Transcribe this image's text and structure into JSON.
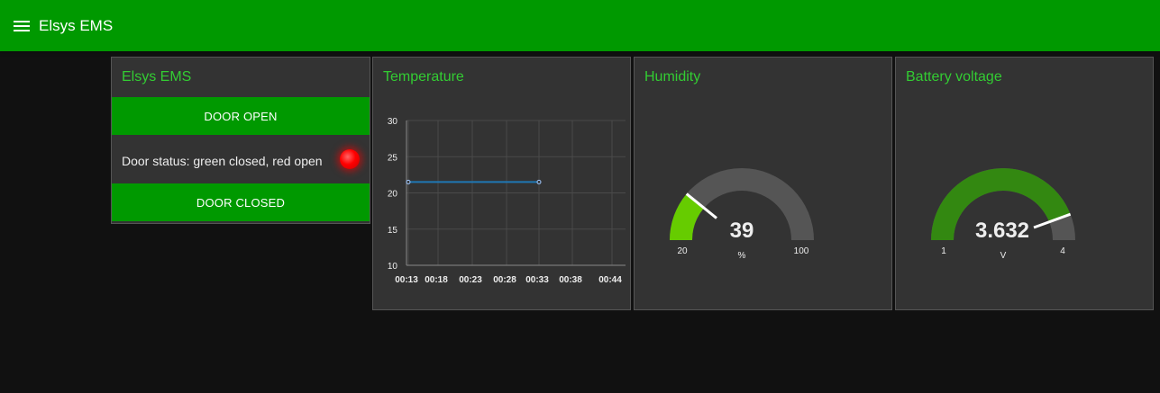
{
  "toolbar": {
    "title": "Elsys EMS",
    "menu_icon": "hamburger-menu-icon"
  },
  "door_card": {
    "title": "Elsys EMS",
    "open_button": "DOOR OPEN",
    "status_text": "Door status: green closed, red open",
    "led_color": "#ff0000",
    "closed_button": "DOOR CLOSED"
  },
  "temperature": {
    "title": "Temperature",
    "chart_data": {
      "type": "line",
      "title": "Temperature",
      "x_ticks": [
        "00:13",
        "00:18",
        "00:23",
        "00:28",
        "00:33",
        "00:38",
        "00:44"
      ],
      "y_ticks": [
        30,
        25,
        20,
        15,
        10
      ],
      "ylim": [
        10,
        30
      ],
      "series": [
        {
          "color": "#1f77b4",
          "points": [
            {
              "x": "00:13",
              "y": 21.5
            },
            {
              "x": "00:33",
              "y": 21.5
            }
          ]
        }
      ],
      "grid": true
    }
  },
  "humidity": {
    "title": "Humidity",
    "value": "39",
    "units": "%",
    "min": "20",
    "max": "100",
    "color": "#66cc00"
  },
  "battery": {
    "title": "Battery voltage",
    "value": "3.632",
    "units": "V",
    "min": "1",
    "max": "4",
    "color": "#338811"
  },
  "colors": {
    "accent": "#009900",
    "title_green": "#33cc33",
    "card_bg": "#333333",
    "page_bg": "#111111",
    "gauge_track": "#555555"
  }
}
